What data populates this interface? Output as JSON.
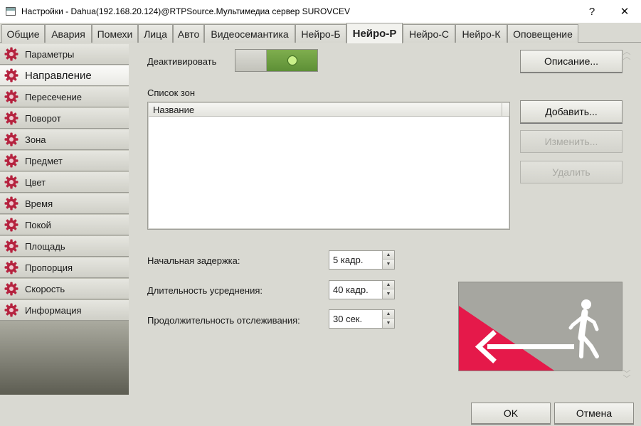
{
  "window": {
    "title": "Настройки - Dahua(192.168.20.124)@RTPSource.Мультимедиа сервер SUROVCEV",
    "help_label": "?",
    "close_label": "✕"
  },
  "tabs": [
    {
      "label": "Общие"
    },
    {
      "label": "Авария"
    },
    {
      "label": "Помехи"
    },
    {
      "label": "Лица"
    },
    {
      "label": "Авто"
    },
    {
      "label": "Видеосемантика"
    },
    {
      "label": "Нейро-Б"
    },
    {
      "label": "Нейро-Р",
      "active": true
    },
    {
      "label": "Нейро-С"
    },
    {
      "label": "Нейро-К"
    },
    {
      "label": "Оповещение"
    }
  ],
  "sidebar": {
    "items": [
      {
        "label": "Параметры"
      },
      {
        "label": "Направление",
        "active": true
      },
      {
        "label": "Пересечение"
      },
      {
        "label": "Поворот"
      },
      {
        "label": "Зона"
      },
      {
        "label": "Предмет"
      },
      {
        "label": "Цвет"
      },
      {
        "label": "Время"
      },
      {
        "label": "Покой"
      },
      {
        "label": "Площадь"
      },
      {
        "label": "Пропорция"
      },
      {
        "label": "Скорость"
      },
      {
        "label": "Информация"
      }
    ]
  },
  "main": {
    "deactivate_label": "Деактивировать",
    "toggle_on": true,
    "description_button": "Описание...",
    "zones_label": "Список зон",
    "zones_column": "Название",
    "add_button": "Добавить...",
    "edit_button": "Изменить...",
    "delete_button": "Удалить",
    "initial_delay_label": "Начальная задержка:",
    "initial_delay_value": "5 кадр.",
    "averaging_label": "Длительность усреднения:",
    "averaging_value": "40 кадр.",
    "tracking_label": "Продолжительность отслеживания:",
    "tracking_value": "30 сек."
  },
  "footer": {
    "ok_button": "OK",
    "cancel_button": "Отмена"
  },
  "colors": {
    "accent_red": "#e5194a",
    "toggle_green": "#6a9a3e",
    "gear_red": "#b5233f"
  }
}
